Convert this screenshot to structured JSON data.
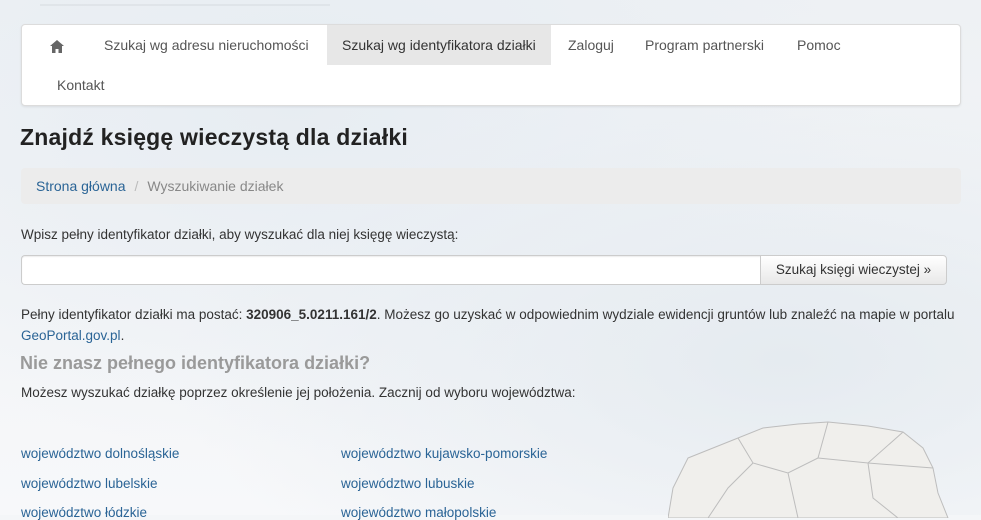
{
  "nav": {
    "items": [
      {
        "label": "Szukaj wg adresu nieruchomości"
      },
      {
        "label": "Szukaj wg identyfikatora działki"
      },
      {
        "label": "Zaloguj"
      },
      {
        "label": "Program partnerski"
      },
      {
        "label": "Pomoc"
      },
      {
        "label": "Kontakt"
      }
    ],
    "active_index": 1
  },
  "page": {
    "title": "Znajdź księgę wieczystą dla działki"
  },
  "breadcrumb": {
    "home": "Strona główna",
    "separator": "/",
    "current": "Wyszukiwanie działek"
  },
  "search": {
    "label": "Wpisz pełny identyfikator działki, aby wyszukać dla niej księgę wieczystą:",
    "value": "",
    "button": "Szukaj księgi wieczystej »"
  },
  "info": {
    "prefix": "Pełny identyfikator działki ma postać: ",
    "example": "320906_5.0211.161/2",
    "middle": ". Możesz go uzyskać w odpowiednim wydziale ewidencji gruntów lub znaleźć na mapie w portalu ",
    "link": "GeoPortal.gov.pl",
    "suffix": "."
  },
  "unknown": {
    "heading": "Nie znasz pełnego identyfikatora działki?",
    "text": "Możesz wyszukać działkę poprzez określenie jej położenia. Zacznij od wyboru województwa:"
  },
  "regions": [
    "województwo dolnośląskie",
    "województwo kujawsko-pomorskie",
    "województwo lubelskie",
    "województwo lubuskie",
    "województwo łódzkie",
    "województwo małopolskie"
  ],
  "colors": {
    "link": "#2a6496",
    "active_nav": "#e7e7e7",
    "breadcrumb_bg": "#ececec"
  }
}
